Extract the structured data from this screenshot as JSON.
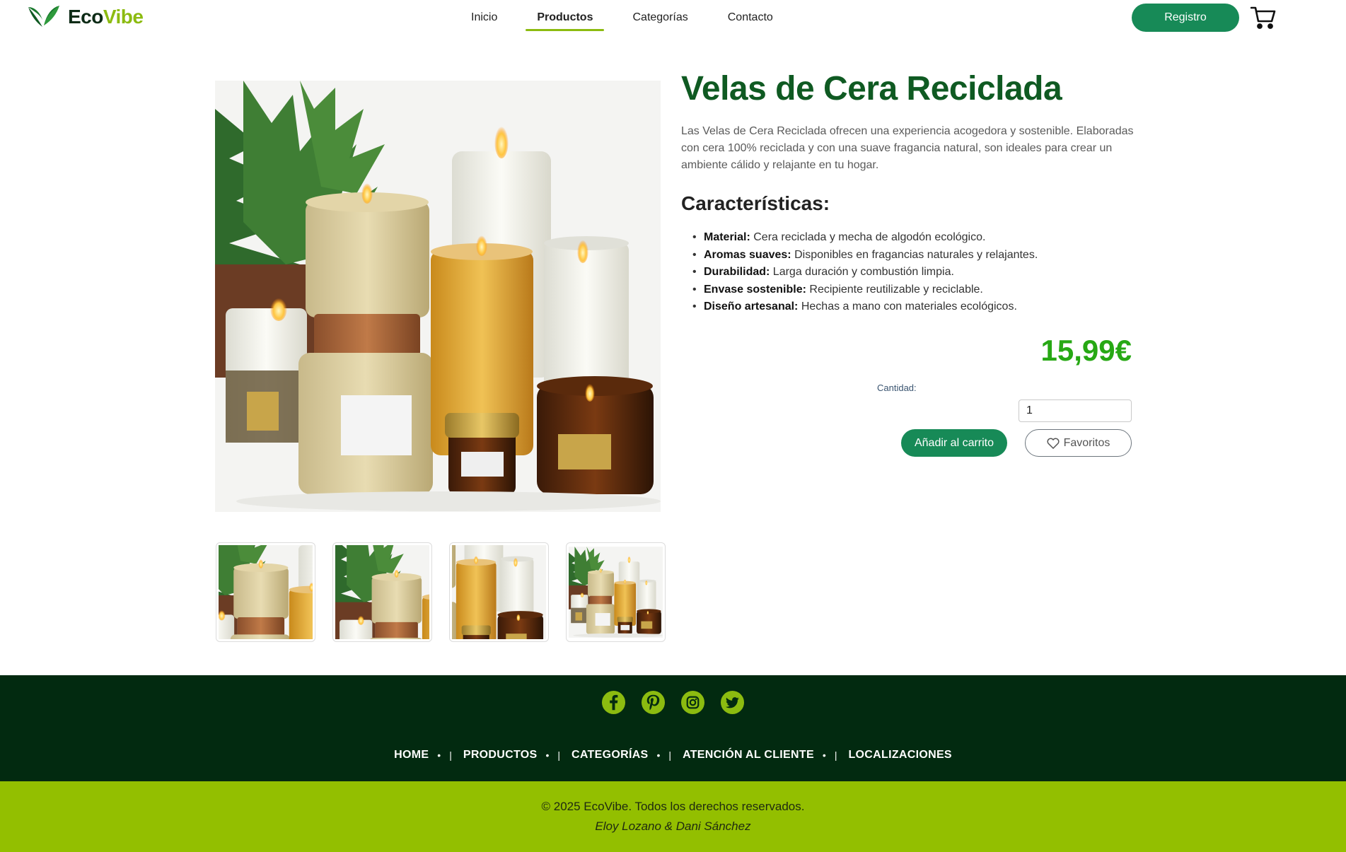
{
  "brand": {
    "eco": "Eco",
    "vibe": "Vibe",
    "colors": {
      "primary": "#178a57",
      "accent": "#8cbb10",
      "dark": "#022a10"
    }
  },
  "nav": {
    "items": [
      {
        "label": "Inicio"
      },
      {
        "label": "Productos",
        "active": true
      },
      {
        "label": "Categorías"
      },
      {
        "label": "Contacto"
      }
    ],
    "register_label": "Registro",
    "cart_icon": "cart-icon"
  },
  "product": {
    "title": "Velas de Cera Reciclada",
    "description": "Las Velas de Cera Reciclada ofrecen una experiencia acogedora y sostenible. Elaboradas con cera 100% reciclada y con una suave fragancia natural, son ideales para crear un ambiente cálido y relajante en tu hogar.",
    "features_title": "Características:",
    "features": [
      {
        "name": "Material:",
        "text": "Cera reciclada y mecha de algodón ecológico."
      },
      {
        "name": "Aromas suaves:",
        "text": "Disponibles en fragancias naturales y relajantes."
      },
      {
        "name": "Durabilidad:",
        "text": "Larga duración y combustión limpia."
      },
      {
        "name": "Envase sostenible:",
        "text": "Recipiente reutilizable y reciclable."
      },
      {
        "name": "Diseño artesanal:",
        "text": "Hechas a mano con materiales ecológicos."
      }
    ],
    "price": "15,99€",
    "quantity_label": "Cantidad:",
    "quantity_value": "1",
    "add_to_cart_label": "Añadir al carrito",
    "favorites_label": "Favoritos"
  },
  "footer": {
    "socials": [
      "facebook-icon",
      "pinterest-icon",
      "instagram-icon",
      "twitter-icon"
    ],
    "links": [
      {
        "label": "HOME"
      },
      {
        "label": "PRODUCTOS"
      },
      {
        "label": "CATEGORÍAS"
      },
      {
        "label": "ATENCIÓN AL CLIENTE"
      },
      {
        "label": "LOCALIZACIONES"
      }
    ],
    "separator": "|",
    "dot": "•",
    "copyright": "© 2025 EcoVibe. Todos los derechos reservados.",
    "authors": "Eloy Lozano & Dani Sánchez"
  }
}
